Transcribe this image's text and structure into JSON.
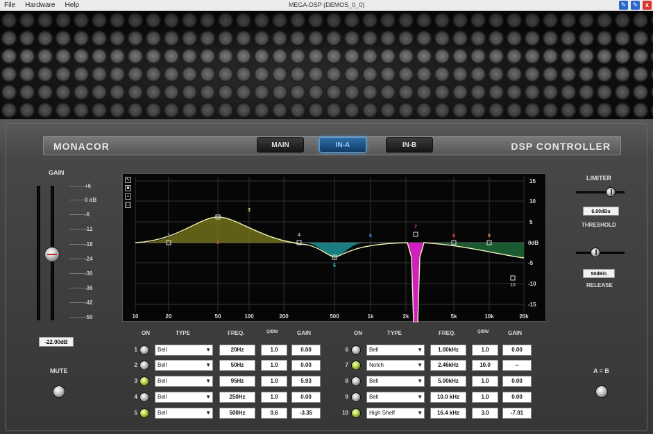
{
  "menu": {
    "file": "File",
    "hardware": "Hardware",
    "help": "Help"
  },
  "window": {
    "title": "MEGA-DSP (DEMOS_0_0)",
    "min_glyph": "✎",
    "max_glyph": "✎",
    "close_glyph": "x"
  },
  "header": {
    "brand": "MONACOR",
    "product": "DSP CONTROLLER"
  },
  "tabs": [
    {
      "label": "MAIN",
      "active": false
    },
    {
      "label": "IN-A",
      "active": true
    },
    {
      "label": "IN-B",
      "active": false
    }
  ],
  "gain": {
    "title": "GAIN",
    "scale": [
      "+6",
      "0 dB",
      "-6",
      "-12",
      "-18",
      "-24",
      "-30",
      "-36",
      "-42",
      "-50"
    ],
    "readout": "-22.00dB",
    "mute_label": "MUTE"
  },
  "limiter": {
    "title": "LIMITER",
    "threshold_value": "6.00dBu",
    "threshold_label": "THRESHOLD",
    "release_value": "50dB/s",
    "release_label": "RELEASE"
  },
  "graph": {
    "x_ticks": [
      "10",
      "20",
      "50",
      "100",
      "200",
      "500",
      "1k",
      "2k",
      "5k",
      "10k",
      "20k"
    ],
    "y_ticks": [
      "15",
      "10",
      "5",
      "0dB",
      "-5",
      "-10",
      "-15"
    ],
    "band_labels": [
      "1",
      "2",
      "3",
      "4",
      "5",
      "6",
      "7",
      "8",
      "9",
      "10"
    ]
  },
  "eq": {
    "headers": {
      "on": "ON",
      "type": "TYPE",
      "freq": "FREQ.",
      "q": "Q/BW",
      "gain": "GAIN"
    },
    "bands": [
      {
        "num": "1",
        "on": false,
        "type": "Bell",
        "freq": "20Hz",
        "q": "1.0",
        "gain": "0.00"
      },
      {
        "num": "2",
        "on": false,
        "type": "Bell",
        "freq": "50Hz",
        "q": "1.0",
        "gain": "0.00"
      },
      {
        "num": "3",
        "on": true,
        "type": "Bell",
        "freq": "95Hz",
        "q": "1.0",
        "gain": "5.93"
      },
      {
        "num": "4",
        "on": false,
        "type": "Bell",
        "freq": "250Hz",
        "q": "1.0",
        "gain": "0.00"
      },
      {
        "num": "5",
        "on": true,
        "type": "Bell",
        "freq": "500Hz",
        "q": "0.6",
        "gain": "-3.35"
      },
      {
        "num": "6",
        "on": false,
        "type": "Bell",
        "freq": "1.00kHz",
        "q": "1.0",
        "gain": "0.00"
      },
      {
        "num": "7",
        "on": true,
        "type": "Notch",
        "freq": "2.46kHz",
        "q": "10.0",
        "gain": "--"
      },
      {
        "num": "8",
        "on": false,
        "type": "Bell",
        "freq": "5.00kHz",
        "q": "1.0",
        "gain": "0.00"
      },
      {
        "num": "9",
        "on": false,
        "type": "Bell",
        "freq": "10.0 kHz",
        "q": "1.0",
        "gain": "0.00"
      },
      {
        "num": "10",
        "on": true,
        "type": "High Shelf",
        "freq": "16.4 kHz",
        "q": "3.0",
        "gain": "-7.01"
      }
    ]
  },
  "ab": {
    "label": "A = B"
  },
  "colors": {
    "tab_active": "#2e6ea8",
    "curve": "#f2f2b8",
    "band3_fill": "#8a8a22",
    "band5_fill": "#1e9aa0",
    "band7_fill": "#d020c0",
    "band10_fill": "#1e6a3a",
    "on_green": "#b8d64a"
  }
}
